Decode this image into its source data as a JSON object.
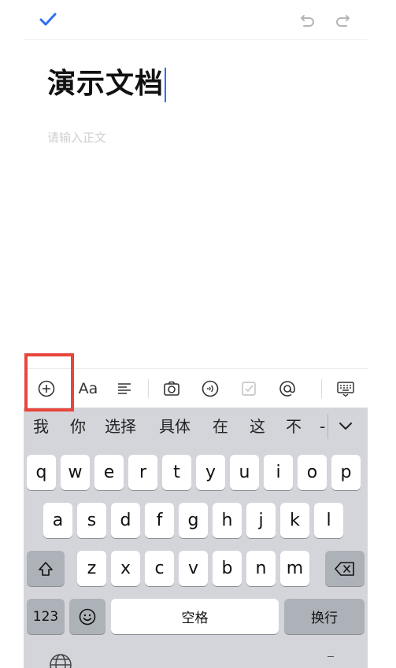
{
  "title": "演示文档",
  "body_placeholder": "请输入正文",
  "toolbar": {
    "icons": [
      "add-icon",
      "text-format-icon",
      "paragraph-align-icon",
      "camera-icon",
      "audio-icon",
      "checkbox-icon",
      "mention-icon",
      "keyboard-hide-icon"
    ],
    "text_format_label": "Aa"
  },
  "keyboard": {
    "candidates": [
      "我",
      "你",
      "选择",
      "具体",
      "在",
      "这",
      "不",
      "-"
    ],
    "row1": [
      "q",
      "w",
      "e",
      "r",
      "t",
      "y",
      "u",
      "i",
      "o",
      "p"
    ],
    "row2": [
      "a",
      "s",
      "d",
      "f",
      "g",
      "h",
      "j",
      "k",
      "l"
    ],
    "row3": [
      "z",
      "x",
      "c",
      "v",
      "b",
      "n",
      "m"
    ],
    "numbers_label": "123",
    "space_label": "空格",
    "return_label": "换行"
  },
  "colors": {
    "accent": "#2e6ff2",
    "highlight": "#e8453c",
    "keyboard_bg": "#d3d5db"
  }
}
